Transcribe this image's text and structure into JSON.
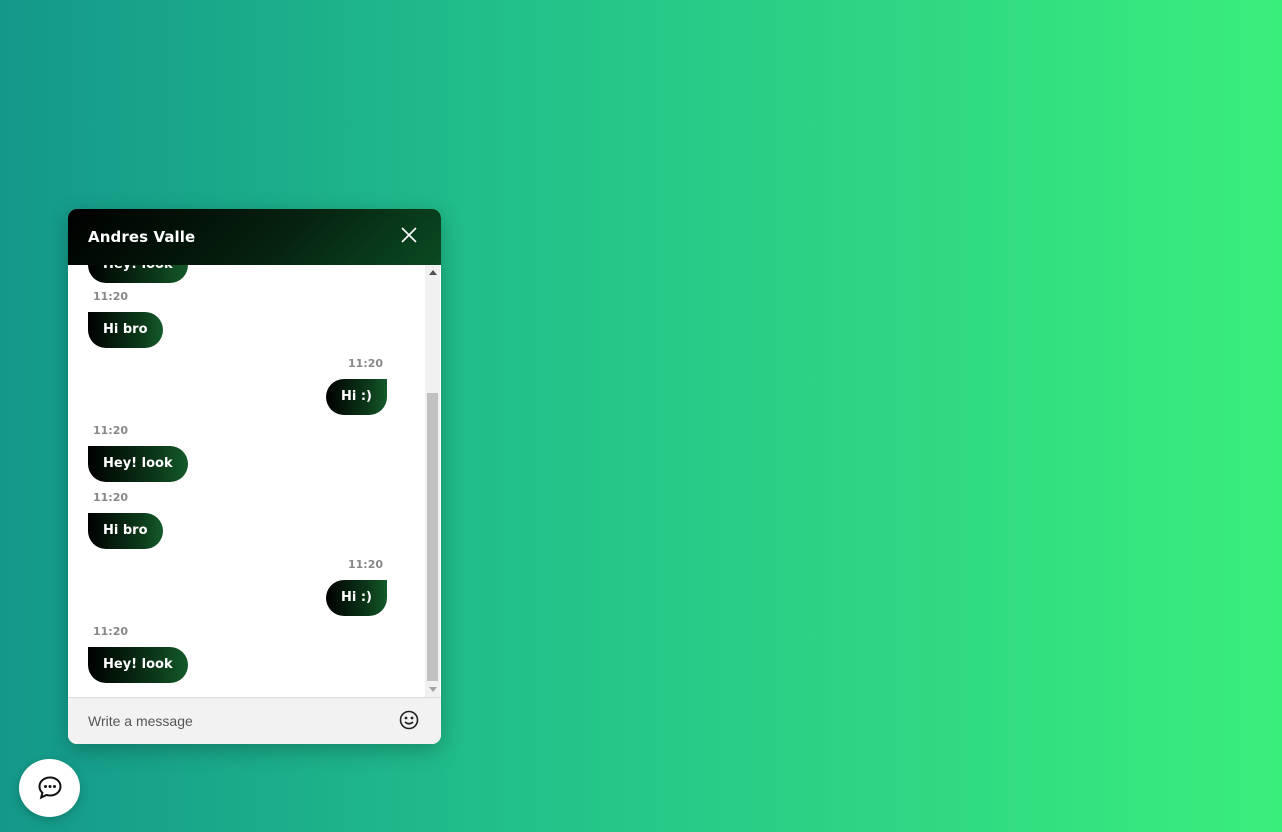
{
  "chat": {
    "title": "Andres Valle",
    "messages": [
      {
        "direction": "in",
        "text": "Hey! look",
        "time": ""
      },
      {
        "direction": "in",
        "text": "Hi bro",
        "time": "11:20"
      },
      {
        "direction": "out",
        "text": "Hi :)",
        "time": "11:20"
      },
      {
        "direction": "in",
        "text": "Hey! look",
        "time": "11:20"
      },
      {
        "direction": "in",
        "text": "Hi bro",
        "time": "11:20"
      },
      {
        "direction": "out",
        "text": "Hi :)",
        "time": "11:20"
      },
      {
        "direction": "in",
        "text": "Hey! look",
        "time": "11:20"
      }
    ],
    "input": {
      "placeholder": "Write a message"
    }
  },
  "icons": {
    "close": "close-icon",
    "emoji": "smiley-face-icon",
    "launcher": "chat-bubble-icon"
  },
  "colors": {
    "background_start": "#14988a",
    "background_end": "#3aee7c",
    "header_dark": "#000000",
    "header_green": "#0a4a22",
    "bubble_start": "#000000",
    "bubble_end": "#145a2a"
  }
}
